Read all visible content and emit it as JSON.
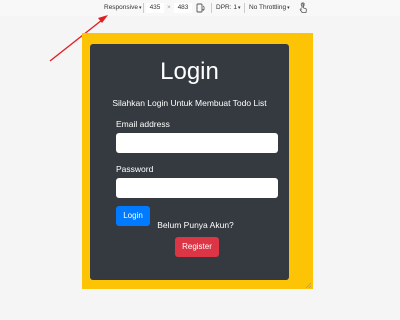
{
  "toolbar": {
    "device": "Responsive",
    "width": "435",
    "times": "×",
    "height": "483",
    "dpr": "DPR: 1",
    "throttling": "No Throttling",
    "icons": [
      "rotate-icon",
      "touch-icon"
    ]
  },
  "annotation": {
    "arrow_color": "#e02020"
  },
  "page": {
    "background": "#fdc305",
    "title": "Login",
    "subtitle": "Silahkan Login Untuk Membuat Todo List",
    "email_label": "Email address",
    "email_value": "",
    "password_label": "Password",
    "password_value": "",
    "login_button": "Login",
    "no_account_text": "Belum Punya Akun?",
    "register_button": "Register"
  }
}
